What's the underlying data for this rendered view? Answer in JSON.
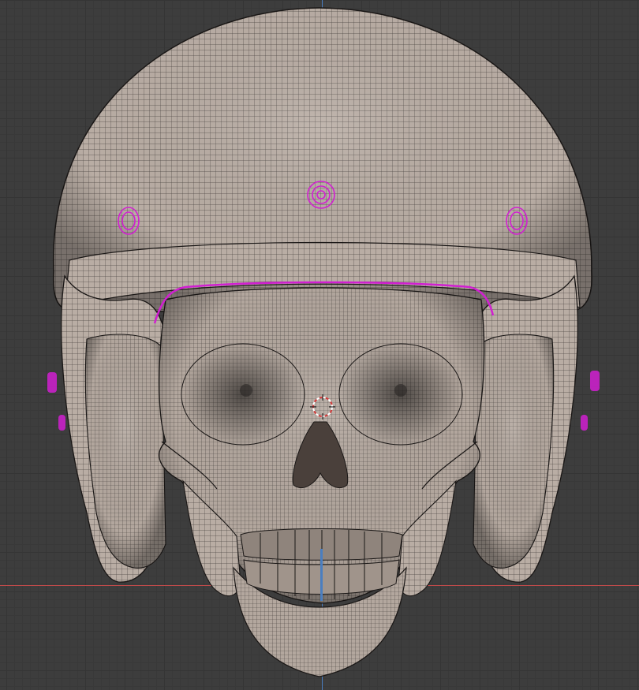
{
  "viewport": {
    "background": "#3d3d3d",
    "grid_color": "#353535"
  },
  "axes": {
    "x_axis_color": "#c04a4a",
    "z_axis_color": "#4a7ec0"
  },
  "model": {
    "mesh_fill": "#b9ada4",
    "wire_color": "#2a2624",
    "selection_color": "#d11fd1"
  },
  "icons": [
    "3d-cursor-icon"
  ]
}
